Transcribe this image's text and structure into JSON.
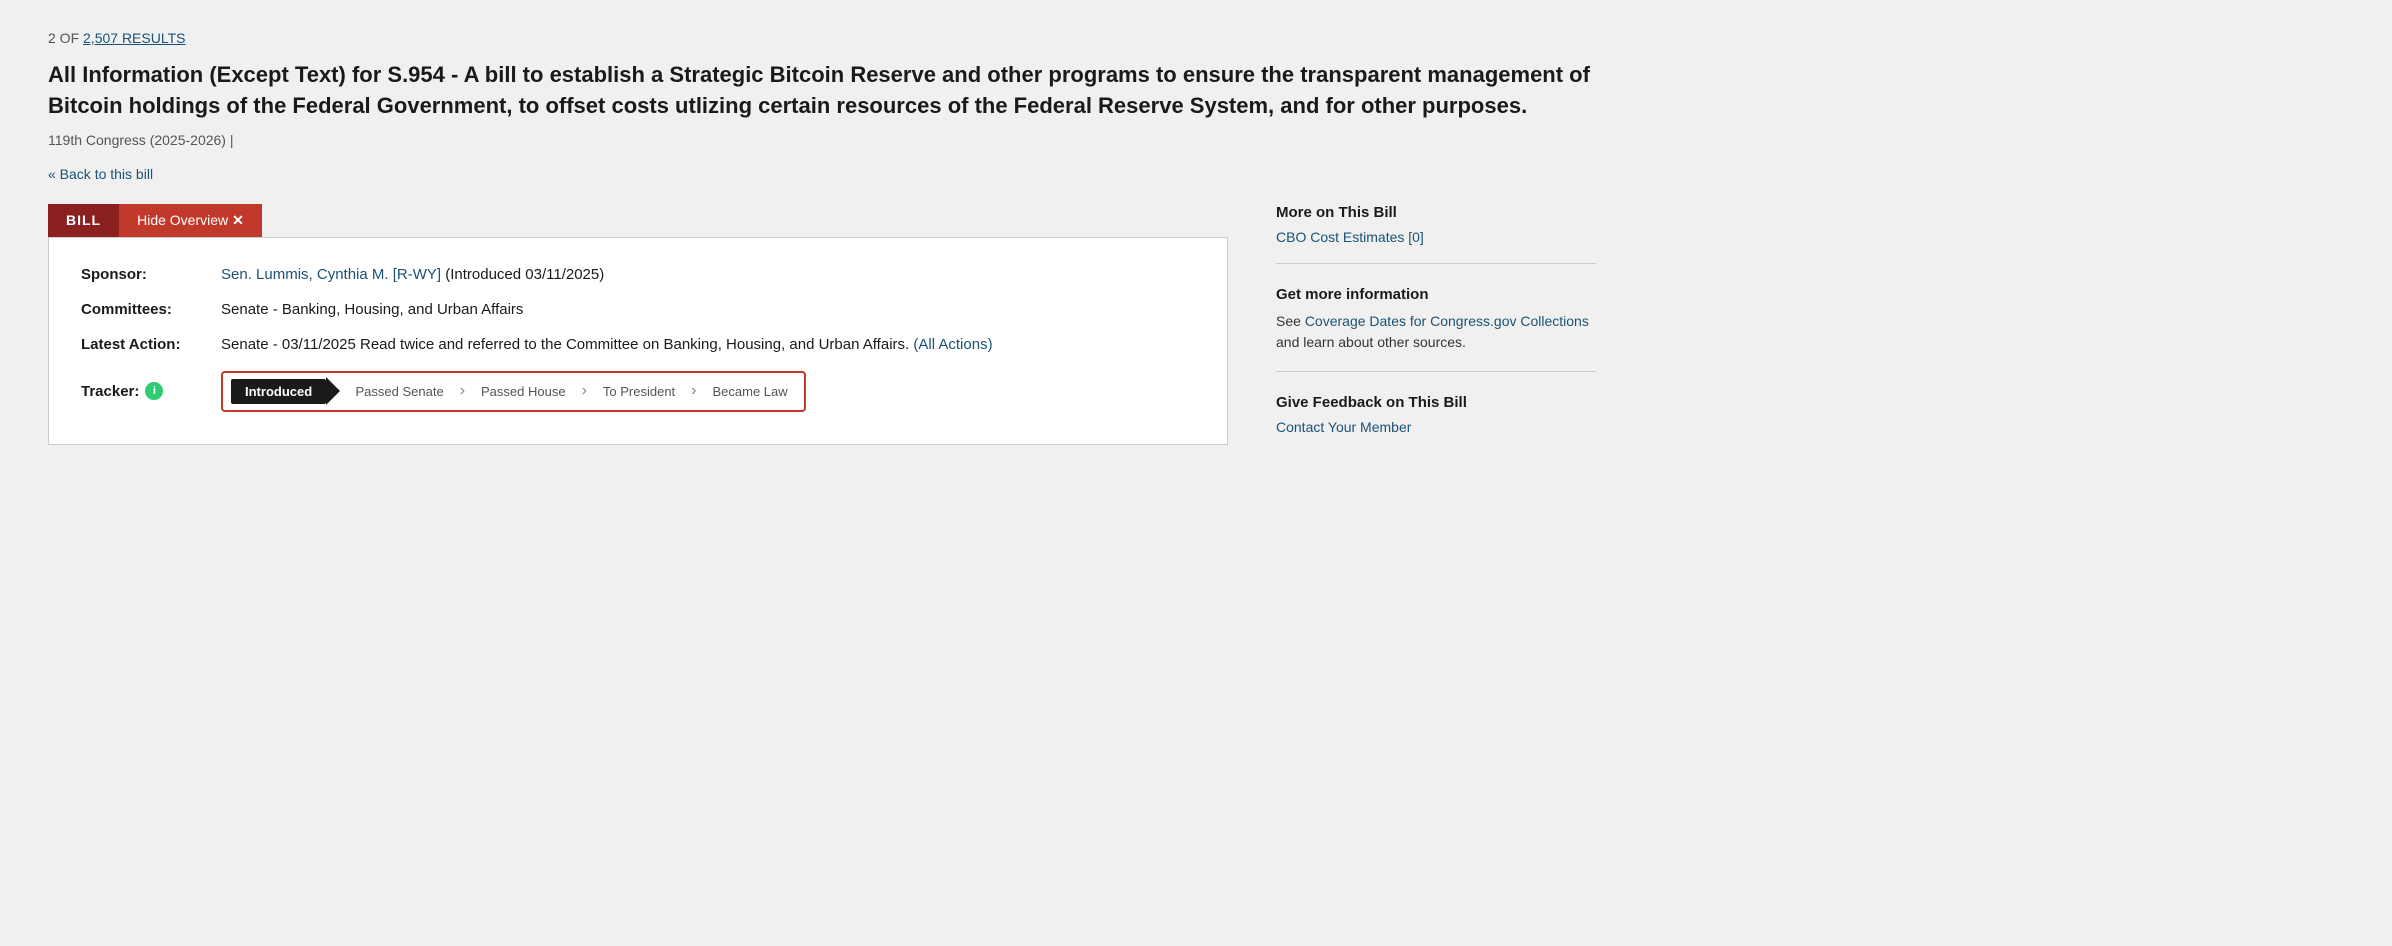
{
  "results": {
    "current": "2",
    "total": "2,507",
    "total_label": "2,507 RESULTS",
    "count_prefix": "2 OF "
  },
  "bill": {
    "title": "All Information (Except Text) for S.954 - A bill to establish a Strategic Bitcoin Reserve and other programs to ensure the transparent management of Bitcoin holdings of the Federal Government, to offset costs utlizing certain resources of the Federal Reserve System, and for other purposes.",
    "congress": "119th Congress (2025-2026) |",
    "back_link_text": "« Back to this bill",
    "tab_bill_label": "BILL",
    "tab_hide_overview_label": "Hide Overview ",
    "tab_hide_overview_x": "✕",
    "sponsor_label": "Sponsor:",
    "sponsor_name": "Sen. Lummis, Cynthia M. [R-WY]",
    "sponsor_introduced": " (Introduced 03/11/2025)",
    "committees_label": "Committees:",
    "committees_value": "Senate - Banking, Housing, and Urban Affairs",
    "latest_action_label": "Latest Action:",
    "latest_action_value": "Senate - 03/11/2025 Read twice and referred to the Committee on Banking, Housing, and Urban Affairs.",
    "latest_action_all_actions": "  (All Actions)",
    "tracker_label": "Tracker:",
    "tracker_steps": [
      {
        "label": "Introduced",
        "active": true
      },
      {
        "label": "Passed Senate",
        "active": false
      },
      {
        "label": "Passed House",
        "active": false
      },
      {
        "label": "To President",
        "active": false
      },
      {
        "label": "Became Law",
        "active": false
      }
    ]
  },
  "sidebar": {
    "more_on_bill_title": "More on This Bill",
    "cbo_cost_estimates": "CBO Cost Estimates [0]",
    "get_more_info_title": "Get more information",
    "get_more_info_text_before": "See ",
    "coverage_dates_link": "Coverage Dates for Congress.gov Collections",
    "get_more_info_text_after": " and learn about other sources.",
    "give_feedback_title": "Give Feedback on This Bill",
    "contact_your_member": "Contact Your Member"
  }
}
